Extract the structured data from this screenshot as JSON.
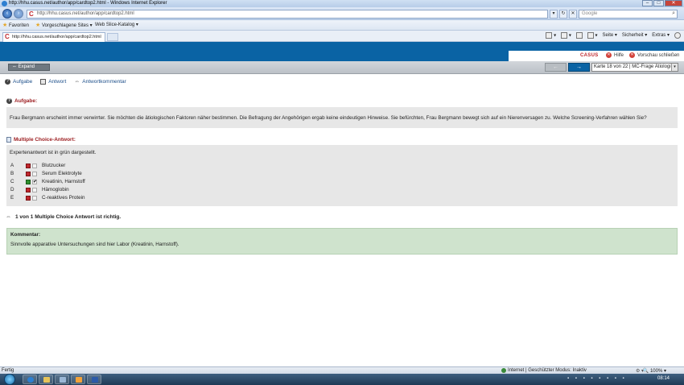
{
  "browser": {
    "window_title": "http://hhu.casus.net/author/app/cardtop2.html - Windows Internet Explorer",
    "address_url": "http://hhu.casus.net/author/app/cardtop2.html",
    "search_placeholder": "Google",
    "favorites": [
      "Favoriten",
      "Vorgeschlagene Sites",
      "Web Slice-Katalog"
    ],
    "tab_title": "http://hhu.casus.net/author/app/cardtop2.html",
    "tools": [
      "Seite",
      "Sicherheit",
      "Extras"
    ],
    "status_left": "Fertig",
    "status_zone": "Internet | Geschützter Modus: Inaktiv",
    "zoom": "100%",
    "clock": "08:14"
  },
  "casus": {
    "logo": "CASUS",
    "help": "Hilfe",
    "close_preview": "Vorschau schließen",
    "expand": "Expand",
    "card_select": "Karte 18 von 22 | MC-Frage Ätiologie"
  },
  "subtabs": [
    "Aufgabe",
    "Antwort",
    "Antwortkommentar"
  ],
  "task": {
    "title": "Aufgabe:",
    "text": "Frau Bergmann erscheint immer verwirrter. Sie möchten die ätiologischen Faktoren näher bestimmen. Die Befragung der Angehörigen ergab keine eindeutigen Hinweise. Sie befürchten, Frau Bergmann bewegt sich auf ein Nierenversagen zu. Welche Screening-Verfahren wählen Sie?"
  },
  "mc": {
    "title": "Multiple Choice-Antwort:",
    "expert_note": "Expertenantwort ist in grün dargestellt.",
    "options": [
      {
        "letter": "A",
        "text": "Blutzucker",
        "correct": false,
        "checked": false
      },
      {
        "letter": "B",
        "text": "Serum Elektrolyte",
        "correct": false,
        "checked": false
      },
      {
        "letter": "C",
        "text": "Kreatinin, Harnstoff",
        "correct": true,
        "checked": true
      },
      {
        "letter": "D",
        "text": "Hämoglobin",
        "correct": false,
        "checked": false
      },
      {
        "letter": "E",
        "text": "C-reaktives Protein",
        "correct": false,
        "checked": false
      }
    ],
    "result": "1 von 1 Multiple Choice Antwort ist richtig."
  },
  "comment": {
    "title": "Kommentar:",
    "text": "Sinnvolle apparative Untersuchungen sind hier Labor (Kreatinin, Harnstoff)."
  },
  "colors": {
    "casus_blue": "#0a63a4",
    "casus_red": "#9b1b1e",
    "comment_green": "#cfe3cd"
  }
}
